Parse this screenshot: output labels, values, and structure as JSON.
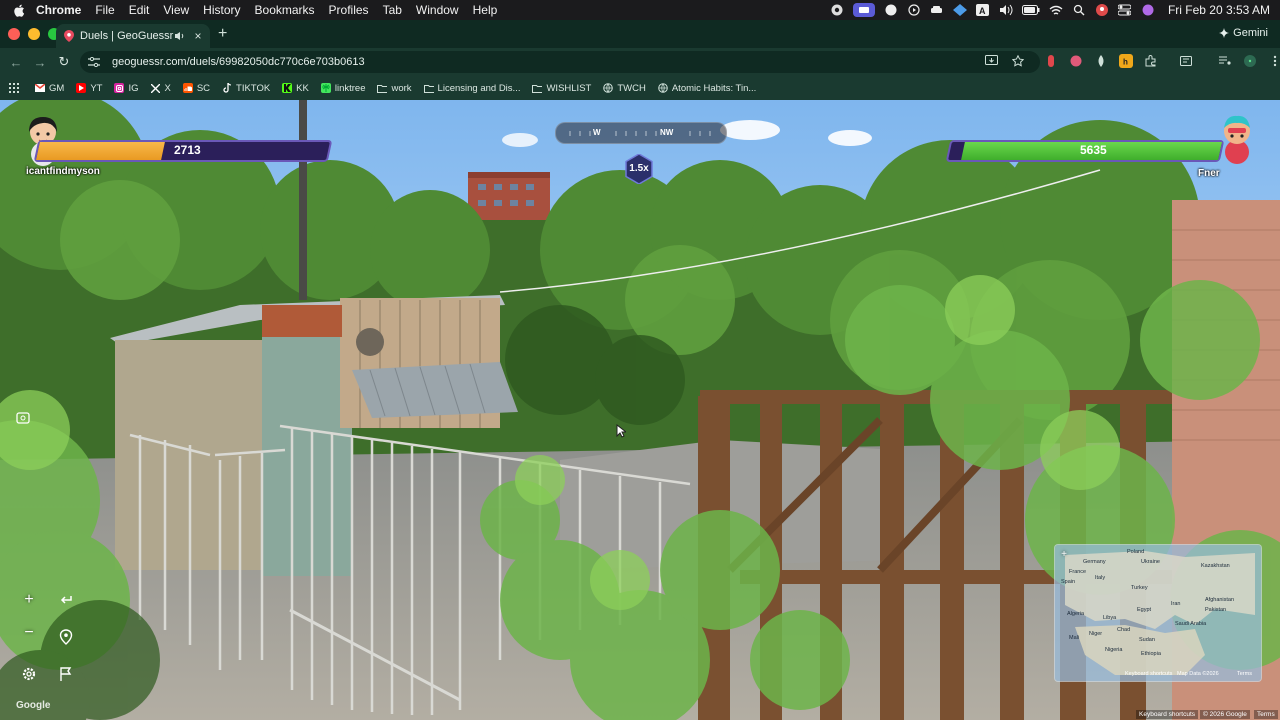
{
  "menubar": {
    "app_name": "Chrome",
    "items": [
      "File",
      "Edit",
      "View",
      "History",
      "Bookmarks",
      "Profiles",
      "Tab",
      "Window",
      "Help"
    ],
    "clock": "Fri Feb 20  3:53 AM"
  },
  "tabs": [
    {
      "title": "Duels | GeoGuessr",
      "active": true
    }
  ],
  "gemini_label": "Gemini",
  "address_bar": {
    "url": "geoguessr.com/duels/69982050dc770c6e703b0613"
  },
  "bookmarks": [
    {
      "label": "GM",
      "icon": "gmail-icon",
      "color": "#ea4335"
    },
    {
      "label": "YT",
      "icon": "youtube-icon",
      "color": "#ff0000"
    },
    {
      "label": "IG",
      "icon": "instagram-icon",
      "color": "#d6249f"
    },
    {
      "label": "X",
      "icon": "x-icon",
      "color": "#ffffff"
    },
    {
      "label": "SC",
      "icon": "soundcloud-icon",
      "color": "#ff5500"
    },
    {
      "label": "TIKTOK",
      "icon": "tiktok-icon",
      "color": "#ffffff"
    },
    {
      "label": "KK",
      "icon": "kick-icon",
      "color": "#53fc18"
    },
    {
      "label": "linktree",
      "icon": "linktree-icon",
      "color": "#43e55e"
    },
    {
      "label": "work",
      "icon": "folder-icon",
      "color": "#cfe0d9"
    },
    {
      "label": "Licensing and Dis...",
      "icon": "folder-icon",
      "color": "#cfe0d9"
    },
    {
      "label": "WISHLIST",
      "icon": "folder-icon",
      "color": "#cfe0d9"
    },
    {
      "label": "TWCH",
      "icon": "globe-icon",
      "color": "#cfe0d9"
    },
    {
      "label": "Atomic Habits: Tin...",
      "icon": "globe-icon",
      "color": "#cfe0d9"
    }
  ],
  "game": {
    "player_left": {
      "name": "icantfindmyson",
      "score": "2713",
      "health_fraction": 0.43
    },
    "player_right": {
      "name": "Fner",
      "score": "5635",
      "health_fraction": 0.95
    },
    "compass": {
      "labels": [
        "W",
        "NW"
      ]
    },
    "multiplier": "1.5x",
    "minimap": {
      "labels": [
        "Poland",
        "Germany",
        "France",
        "Spain",
        "Italy",
        "Ukraine",
        "Kazakhstan",
        "Turkey",
        "Algeria",
        "Libya",
        "Egypt",
        "Iran",
        "Mali",
        "Niger",
        "Chad",
        "Sudan",
        "Saudi Arabia",
        "Afghanistan",
        "Pakistan",
        "Nigeria",
        "Ethiopia"
      ],
      "attribution": [
        "Keyboard shortcuts",
        "Map Data ©2026",
        "Terms"
      ]
    },
    "google_logo": "Google",
    "footer_attribution": [
      "Keyboard shortcuts",
      "© 2026 Google",
      "Terms"
    ]
  }
}
